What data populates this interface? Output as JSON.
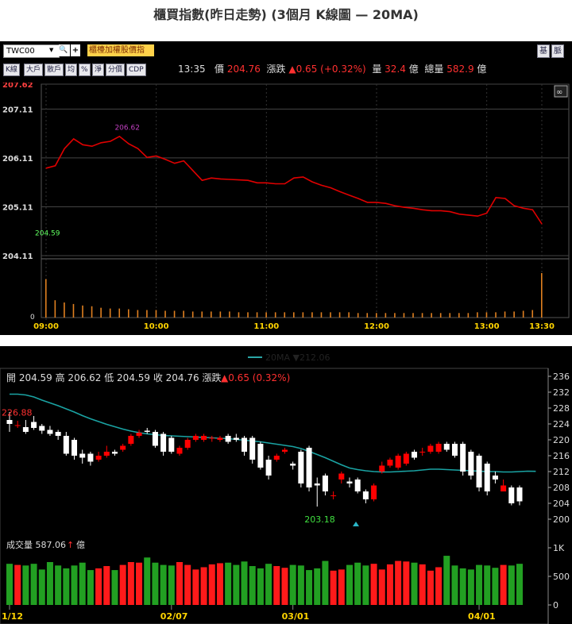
{
  "title": "櫃買指數(昨日走勢) (3個月 K線圖 — 20MA)",
  "intraday": {
    "toolbar": {
      "symbol_input": "TWC00",
      "dropdown_glyph": "▼",
      "search_glyph": "🔍",
      "add_glyph": "+",
      "index_name": "櫃檯加權股價指",
      "buttons": [
        "K線",
        "大戶",
        "散戶",
        "均",
        "%",
        "淨",
        "分價",
        "CDP"
      ],
      "right_buttons": [
        "基",
        "脈"
      ]
    },
    "quote": {
      "time": "13:35",
      "price_label": "價",
      "price": "204.76",
      "change_label": "漲跌",
      "change": "▲0.65 (+0.32%)",
      "vol_label": "量",
      "vol": "32.4",
      "vol_unit": "億",
      "total_label": "總量",
      "total": "582.9",
      "total_unit": "億"
    },
    "colors": {
      "line": "#e00000",
      "up": "#ff3030",
      "grid": "#444444",
      "tick": "#ffd400"
    }
  },
  "daily": {
    "legend": {
      "label": "20MA",
      "arrow": "▼",
      "value": "212.06",
      "color": "#2aa6a6"
    },
    "ohlc_text": {
      "open_label": "開",
      "open": "204.59",
      "high_label": "高",
      "high": "206.62",
      "low_label": "低",
      "low": "204.59",
      "close_label": "收",
      "close": "204.76",
      "change_label": "漲跌",
      "change": "▲0.65 (0.32%)"
    },
    "volume_header": {
      "label": "成交量",
      "value": "587.06",
      "arrow": "↑",
      "unit": "億"
    },
    "colors": {
      "up": "#ff0000",
      "down": "#ffffff",
      "vol_up": "#ff1a1a",
      "vol_down": "#22a022",
      "ma": "#1aa3a3"
    }
  },
  "chart_data": [
    {
      "type": "line",
      "x": [
        "09:00",
        "09:05",
        "09:10",
        "09:15",
        "09:20",
        "09:25",
        "09:30",
        "09:35",
        "09:40",
        "09:45",
        "09:50",
        "09:55",
        "10:00",
        "10:05",
        "10:10",
        "10:15",
        "10:20",
        "10:25",
        "10:30",
        "10:35",
        "10:40",
        "10:45",
        "10:50",
        "10:55",
        "11:00",
        "11:05",
        "11:10",
        "11:15",
        "11:20",
        "11:25",
        "11:30",
        "11:35",
        "11:40",
        "11:45",
        "11:50",
        "11:55",
        "12:00",
        "12:05",
        "12:10",
        "12:15",
        "12:20",
        "12:25",
        "12:30",
        "12:35",
        "12:40",
        "12:45",
        "12:50",
        "12:55",
        "13:00",
        "13:05",
        "13:10",
        "13:15",
        "13:20",
        "13:25",
        "13:30"
      ],
      "series": [
        {
          "values": [
            205.9,
            205.95,
            206.3,
            206.5,
            206.38,
            206.35,
            206.42,
            206.45,
            206.55,
            206.4,
            206.3,
            206.12,
            206.15,
            206.08,
            206.0,
            206.05,
            205.85,
            205.65,
            205.7,
            205.68,
            205.67,
            205.66,
            205.65,
            205.6,
            205.6,
            205.58,
            205.58,
            205.7,
            205.72,
            205.62,
            205.55,
            205.5,
            205.42,
            205.35,
            205.28,
            205.2,
            205.2,
            205.18,
            205.13,
            205.1,
            205.08,
            205.05,
            205.03,
            205.03,
            205.01,
            204.96,
            204.94,
            204.92,
            204.98,
            205.3,
            205.28,
            205.13,
            205.08,
            205.05,
            204.76
          ]
        }
      ],
      "ylim": [
        204.11,
        207.62
      ],
      "yticks": [
        "207.62",
        "207.11",
        "206.11",
        "205.11",
        "204.11"
      ],
      "xticks": [
        "09:00",
        "10:00",
        "11:00",
        "12:00",
        "13:00",
        "13:30"
      ],
      "annotations": [
        {
          "text": "206.62"
        },
        {
          "text": "204.59"
        }
      ],
      "volume": {
        "values": [
          5.1,
          2.3,
          2.0,
          1.8,
          1.6,
          1.5,
          1.3,
          1.2,
          1.2,
          1.1,
          1.0,
          1.0,
          1.0,
          0.9,
          0.9,
          0.9,
          0.8,
          0.8,
          0.8,
          0.8,
          0.8,
          0.7,
          0.7,
          0.7,
          0.7,
          0.7,
          0.7,
          0.7,
          0.7,
          0.7,
          0.7,
          0.7,
          0.7,
          0.7,
          0.6,
          0.6,
          0.6,
          0.6,
          0.6,
          0.6,
          0.6,
          0.6,
          0.6,
          0.6,
          0.6,
          0.6,
          0.6,
          0.7,
          0.7,
          0.7,
          0.8,
          0.8,
          0.9,
          1.0,
          5.9
        ],
        "ytick": "0"
      },
      "grid": true
    },
    {
      "type": "candlestick",
      "x": [
        "01/12",
        "01/13",
        "01/14",
        "01/15",
        "01/16",
        "01/19",
        "01/20",
        "01/21",
        "01/22",
        "01/23",
        "01/26",
        "01/27",
        "01/28",
        "01/29",
        "01/30",
        "02/02",
        "02/03",
        "02/04",
        "02/05",
        "02/06",
        "02/07",
        "02/10",
        "02/11",
        "02/12",
        "02/13",
        "02/16",
        "02/17",
        "02/18",
        "02/19",
        "02/20",
        "02/23",
        "02/24",
        "02/25",
        "02/26",
        "02/27",
        "03/01",
        "03/02",
        "03/03",
        "03/04",
        "03/05",
        "03/08",
        "03/09",
        "03/10",
        "03/11",
        "03/12",
        "03/15",
        "03/16",
        "03/17",
        "03/18",
        "03/19",
        "03/22",
        "03/23",
        "03/24",
        "03/25",
        "03/26",
        "03/29",
        "03/30",
        "03/31",
        "04/01",
        "04/02",
        "04/05",
        "04/06",
        "04/07",
        "04/08"
      ],
      "open": [
        225.0,
        223.5,
        223.2,
        224.5,
        223.5,
        222.5,
        222.0,
        221.0,
        220.0,
        216.5,
        216.5,
        215.0,
        216.0,
        217.0,
        217.5,
        219.0,
        221.0,
        222.3,
        222.0,
        221.5,
        220.5,
        216.5,
        218.0,
        220.0,
        220.0,
        220.3,
        220.0,
        221.0,
        220.5,
        220.5,
        220.5,
        219.0,
        215.0,
        215.0,
        217.0,
        214.0,
        217.0,
        218.0,
        209.0,
        211.0,
        206.0,
        210.0,
        209.5,
        210.0,
        207.0,
        205.0,
        212.0,
        213.5,
        213.0,
        214.0,
        217.0,
        217.0,
        217.0,
        217.0,
        219.0,
        219.0,
        219.0,
        217.0,
        216.0,
        214.0,
        211.0,
        207.0,
        208.0,
        208.0,
        208.0,
        204.0
      ],
      "close": [
        224.0,
        223.7,
        222.0,
        223.0,
        222.3,
        221.5,
        221.0,
        216.5,
        216.0,
        215.5,
        214.5,
        216.0,
        217.0,
        216.5,
        218.5,
        221.0,
        221.8,
        222.0,
        218.5,
        217.0,
        217.0,
        218.0,
        220.0,
        221.0,
        221.0,
        220.5,
        220.5,
        219.5,
        220.0,
        217.0,
        215.0,
        213.0,
        211.0,
        216.0,
        217.5,
        213.5,
        209.0,
        208.0,
        208.5,
        207.0,
        206.0,
        211.5,
        209.0,
        207.0,
        205.0,
        208.5,
        213.5,
        215.0,
        216.0,
        216.5,
        215.5,
        217.0,
        218.5,
        219.0,
        217.5,
        216.0,
        212.0,
        211.0,
        208.0,
        207.0,
        210.0,
        208.5,
        204.0,
        204.5,
        205.0,
        204.76
      ],
      "high": [
        227.0,
        224.8,
        225.0,
        226.0,
        224.0,
        223.5,
        222.5,
        222.0,
        220.5,
        217.5,
        217.0,
        217.0,
        218.5,
        217.5,
        219.0,
        221.5,
        222.5,
        223.0,
        222.5,
        222.0,
        221.0,
        218.5,
        220.5,
        221.5,
        221.5,
        221.0,
        221.0,
        221.5,
        221.5,
        221.0,
        221.0,
        219.5,
        216.0,
        216.5,
        218.0,
        214.5,
        217.5,
        218.5,
        210.5,
        211.5,
        207.0,
        212.0,
        210.5,
        210.5,
        207.5,
        209.0,
        214.5,
        215.5,
        216.5,
        217.0,
        217.5,
        218.0,
        219.0,
        219.5,
        219.5,
        219.5,
        219.5,
        217.5,
        216.5,
        214.5,
        212.0,
        210.0,
        208.5,
        208.5,
        208.5,
        206.62
      ],
      "low": [
        222.0,
        223.0,
        221.5,
        222.5,
        221.5,
        221.0,
        220.0,
        216.0,
        215.0,
        214.0,
        213.5,
        214.5,
        215.5,
        216.0,
        217.0,
        218.5,
        220.5,
        221.5,
        218.0,
        216.0,
        216.5,
        216.0,
        217.5,
        219.5,
        219.5,
        219.5,
        219.5,
        219.0,
        219.5,
        216.0,
        214.0,
        212.5,
        210.0,
        214.5,
        216.5,
        212.5,
        208.0,
        207.0,
        203.18,
        206.0,
        205.0,
        209.0,
        208.0,
        206.5,
        204.0,
        204.5,
        211.5,
        213.0,
        212.5,
        213.5,
        215.0,
        216.0,
        216.5,
        216.5,
        217.0,
        215.5,
        211.0,
        210.0,
        207.0,
        206.0,
        209.0,
        207.5,
        203.5,
        203.5,
        204.0,
        204.59
      ],
      "ma20": [
        231.5,
        231.5,
        231.3,
        230.8,
        230.0,
        229.3,
        228.6,
        227.8,
        227.0,
        226.1,
        225.3,
        224.6,
        223.9,
        223.3,
        222.7,
        222.2,
        221.8,
        221.5,
        221.3,
        221.1,
        221.0,
        220.9,
        220.8,
        220.7,
        220.6,
        220.5,
        220.4,
        220.3,
        220.1,
        219.9,
        219.7,
        219.5,
        219.2,
        218.9,
        218.6,
        218.3,
        217.8,
        217.1,
        216.3,
        215.5,
        214.6,
        213.7,
        212.9,
        212.5,
        212.2,
        212.0,
        211.9,
        211.9,
        212.0,
        212.1,
        212.2,
        212.4,
        212.6,
        212.6,
        212.5,
        212.4,
        212.3,
        212.2,
        212.1,
        212.0,
        212.0,
        211.9,
        211.9,
        212.0,
        212.1,
        212.06
      ],
      "volume": [
        720,
        700,
        690,
        720,
        620,
        750,
        690,
        640,
        690,
        740,
        610,
        640,
        680,
        610,
        700,
        750,
        740,
        830,
        740,
        700,
        690,
        750,
        700,
        620,
        660,
        710,
        730,
        740,
        700,
        760,
        680,
        640,
        720,
        680,
        650,
        700,
        690,
        610,
        640,
        770,
        600,
        620,
        700,
        740,
        690,
        720,
        620,
        710,
        770,
        760,
        740,
        710,
        600,
        660,
        860,
        690,
        640,
        620,
        700,
        690,
        650,
        700,
        690,
        720,
        620,
        660
      ],
      "ylim": [
        200,
        236
      ],
      "yticks": [
        "236",
        "232",
        "228",
        "224",
        "220",
        "216",
        "212",
        "208",
        "204",
        "200"
      ],
      "volume_yticks": [
        "1K",
        "500",
        "0"
      ],
      "volume_ylim": [
        0,
        1000
      ],
      "xticks": [
        "1/12",
        "02/07",
        "03/01",
        "04/01"
      ],
      "annotations": [
        {
          "text": "226.88"
        },
        {
          "text": "203.18"
        }
      ],
      "grid": false
    }
  ]
}
